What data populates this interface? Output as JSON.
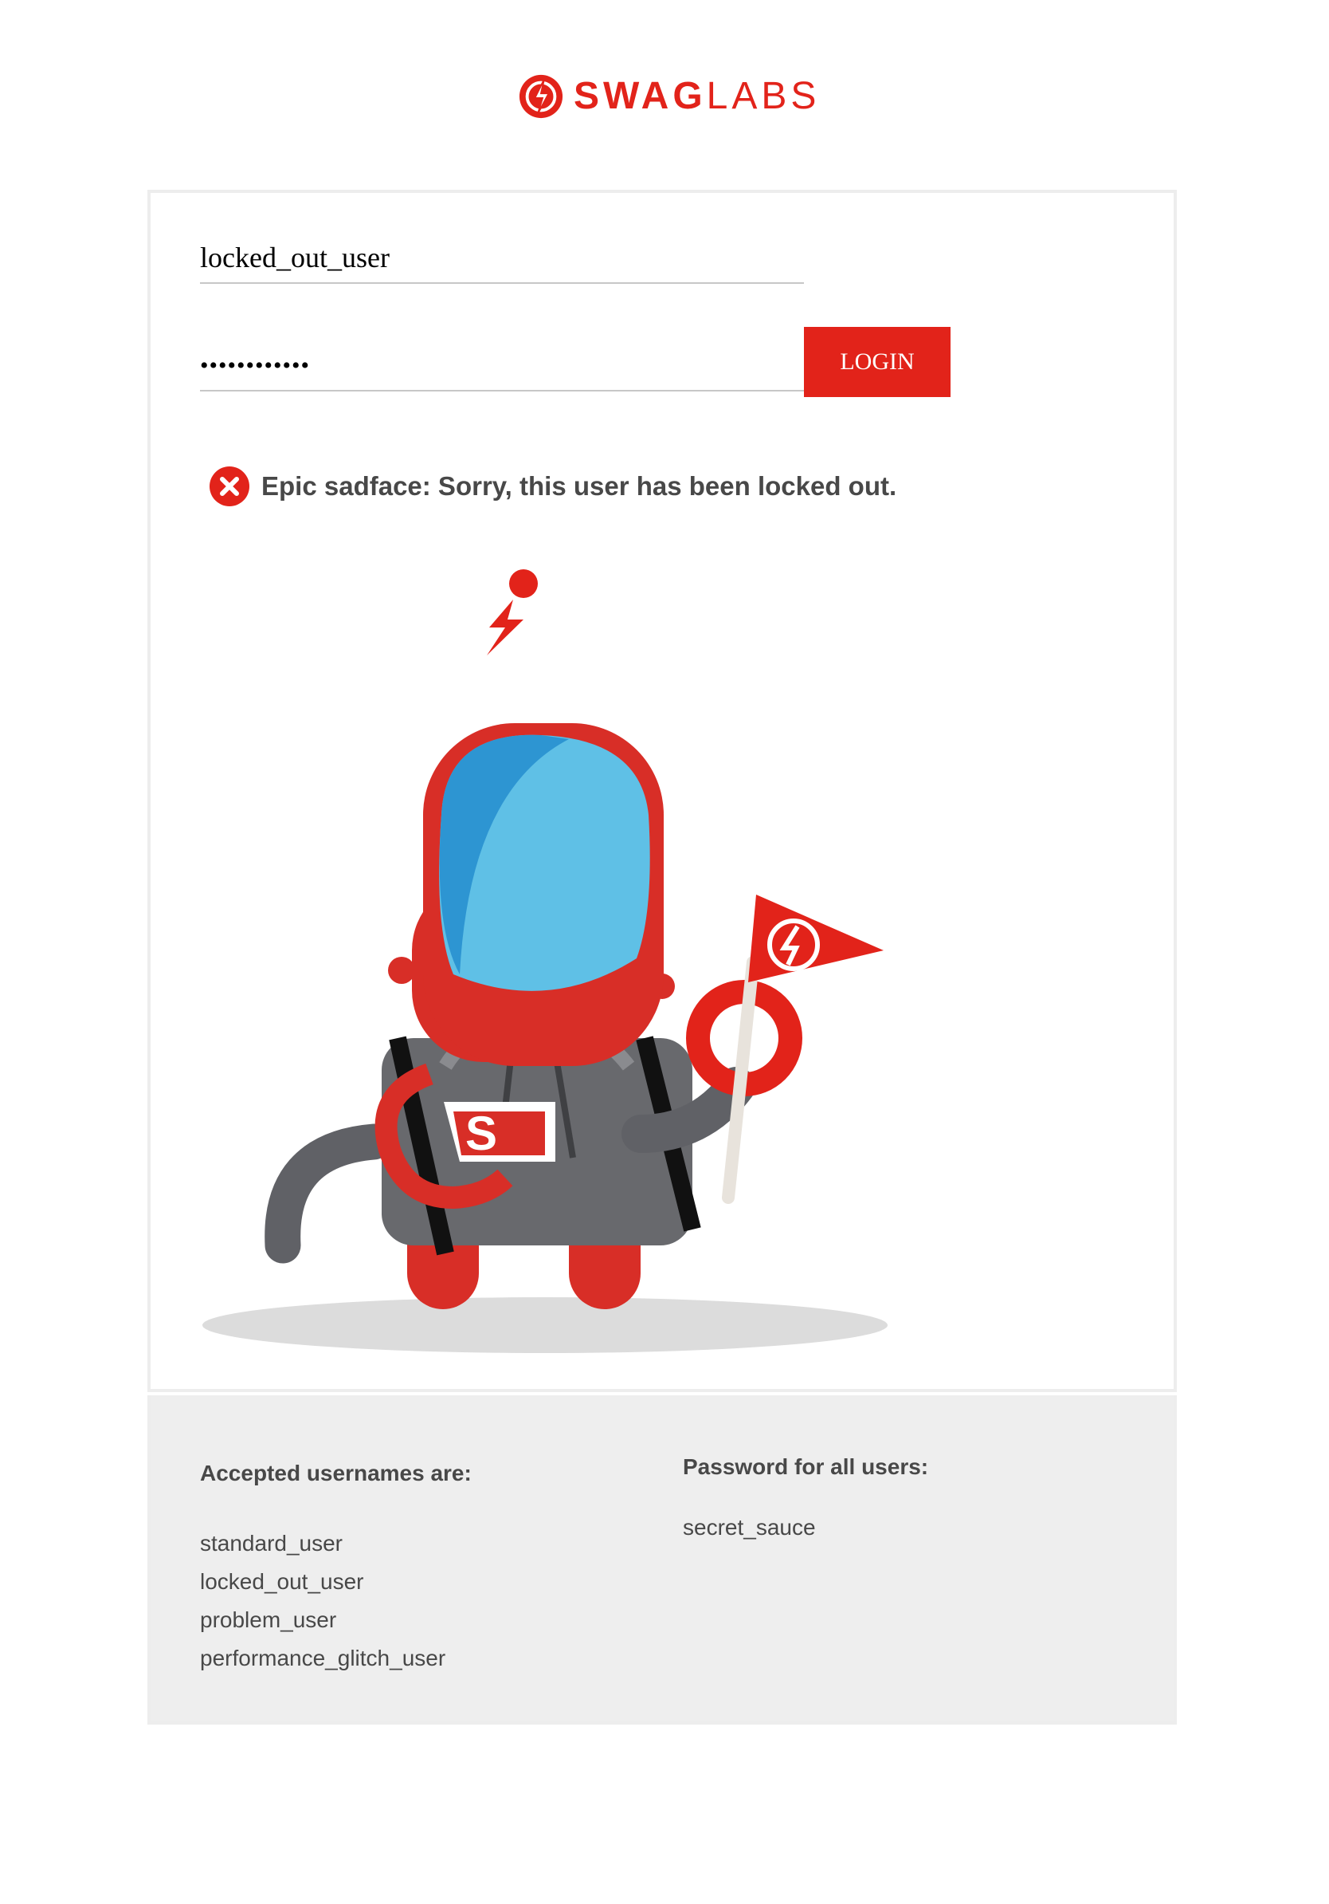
{
  "header": {
    "logo_bold": "SWAG",
    "logo_light": "LABS"
  },
  "login_form": {
    "username_value": "locked_out_user",
    "password_masked": "••••••••••••",
    "login_button_label": "LOGIN",
    "error_message": "Epic sadface: Sorry, this user has been locked out."
  },
  "credentials": {
    "usernames_title": "Accepted usernames are:",
    "usernames": [
      "standard_user",
      "locked_out_user",
      "problem_user",
      "performance_glitch_user"
    ],
    "password_title": "Password for all users:",
    "password": "secret_sauce"
  },
  "colors": {
    "brand_red": "#e2231a",
    "text_gray": "#484848",
    "panel_gray": "#eeeeee"
  },
  "icons": [
    "swag-labs-logo-icon",
    "error-x-circle-icon",
    "robot-mascot-illustration"
  ]
}
